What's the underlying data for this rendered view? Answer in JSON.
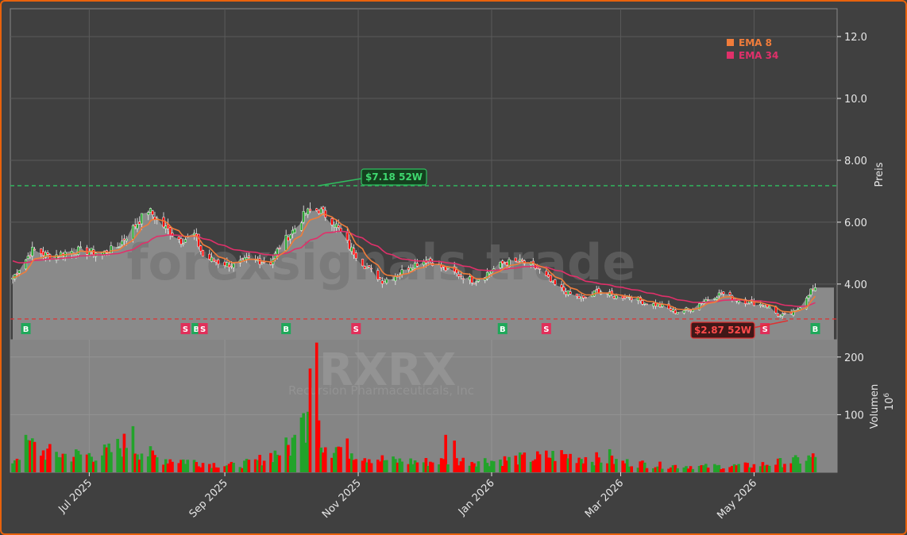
{
  "chart_data": {
    "type": "candlestick",
    "ticker_watermark": "RXRX",
    "company_watermark": "Recursion Pharmaceuticals, Inc",
    "site_watermark": "forexsignals.trade",
    "price_axis": {
      "label": "Preis",
      "ylim": [
        2.2,
        12.9
      ],
      "ticks": [
        "4.00",
        "6.00",
        "8.00",
        "10.0",
        "12.0"
      ]
    },
    "volume_axis": {
      "label": "Volumen",
      "unit": "10^6",
      "ylim": [
        0,
        230
      ],
      "ticks": [
        "100",
        "200"
      ]
    },
    "x_axis": {
      "ticks": [
        {
          "date": "2025-07-01",
          "label": "Jul 2025"
        },
        {
          "date": "2025-09-01",
          "label": "Sep 2025"
        },
        {
          "date": "2025-11-01",
          "label": "Nov 2025"
        },
        {
          "date": "2026-01-01",
          "label": "Jan 2026"
        },
        {
          "date": "2026-03-01",
          "label": "Mar 2026"
        },
        {
          "date": "2026-05-01",
          "label": "May 2026"
        }
      ]
    },
    "legend": [
      {
        "name": "EMA 8",
        "color": "#f07c3a"
      },
      {
        "name": "EMA 34",
        "color": "#e0306a"
      }
    ],
    "high_52w": {
      "value": 7.18,
      "label": "$7.18 52W",
      "date": "2025-10-13"
    },
    "low_52w": {
      "value": 2.87,
      "label": "$2.87 52W",
      "date": "2026-05-13"
    },
    "close_anchors": [
      [
        "2025-05-27",
        4.2
      ],
      [
        "2025-06-05",
        5.1
      ],
      [
        "2025-06-13",
        4.9
      ],
      [
        "2025-06-25",
        5.1
      ],
      [
        "2025-07-07",
        5.0
      ],
      [
        "2025-07-14",
        5.2
      ],
      [
        "2025-07-22",
        5.9
      ],
      [
        "2025-07-28",
        6.4
      ],
      [
        "2025-08-05",
        5.8
      ],
      [
        "2025-08-12",
        5.4
      ],
      [
        "2025-08-18",
        5.6
      ],
      [
        "2025-08-22",
        4.9
      ],
      [
        "2025-08-29",
        4.7
      ],
      [
        "2025-09-05",
        4.6
      ],
      [
        "2025-09-12",
        4.8
      ],
      [
        "2025-09-22",
        4.7
      ],
      [
        "2025-09-26",
        5.2
      ],
      [
        "2025-10-03",
        5.8
      ],
      [
        "2025-10-08",
        6.3
      ],
      [
        "2025-10-14",
        6.4
      ],
      [
        "2025-10-21",
        6.0
      ],
      [
        "2025-10-28",
        5.2
      ],
      [
        "2025-11-04",
        4.6
      ],
      [
        "2025-11-12",
        4.1
      ],
      [
        "2025-11-19",
        4.3
      ],
      [
        "2025-11-25",
        4.6
      ],
      [
        "2025-12-03",
        4.8
      ],
      [
        "2025-12-10",
        4.5
      ],
      [
        "2025-12-17",
        4.3
      ],
      [
        "2025-12-24",
        4.1
      ],
      [
        "2025-12-31",
        4.4
      ],
      [
        "2026-01-07",
        4.7
      ],
      [
        "2026-01-15",
        4.7
      ],
      [
        "2026-01-22",
        4.5
      ],
      [
        "2026-01-29",
        4.0
      ],
      [
        "2026-02-05",
        3.7
      ],
      [
        "2026-02-12",
        3.5
      ],
      [
        "2026-02-19",
        3.8
      ],
      [
        "2026-02-26",
        3.6
      ],
      [
        "2026-03-05",
        3.6
      ],
      [
        "2026-03-12",
        3.4
      ],
      [
        "2026-03-19",
        3.3
      ],
      [
        "2026-03-26",
        3.1
      ],
      [
        "2026-04-02",
        3.2
      ],
      [
        "2026-04-09",
        3.5
      ],
      [
        "2026-04-16",
        3.7
      ],
      [
        "2026-04-23",
        3.5
      ],
      [
        "2026-04-30",
        3.4
      ],
      [
        "2026-05-07",
        3.3
      ],
      [
        "2026-05-13",
        2.95
      ],
      [
        "2026-05-20",
        3.1
      ],
      [
        "2026-05-27",
        3.8
      ]
    ],
    "volume_anchors": [
      [
        "2025-05-27",
        20
      ],
      [
        "2025-06-03",
        50
      ],
      [
        "2025-06-10",
        35
      ],
      [
        "2025-06-20",
        30
      ],
      [
        "2025-07-01",
        30
      ],
      [
        "2025-07-10",
        35
      ],
      [
        "2025-07-18",
        50
      ],
      [
        "2025-07-24",
        40
      ],
      [
        "2025-08-01",
        25
      ],
      [
        "2025-08-15",
        20
      ],
      [
        "2025-08-25",
        15
      ],
      [
        "2025-09-05",
        12
      ],
      [
        "2025-09-15",
        18
      ],
      [
        "2025-09-25",
        35
      ],
      [
        "2025-10-01",
        45
      ],
      [
        "2025-10-06",
        70
      ],
      [
        "2025-10-10",
        130
      ],
      [
        "2025-10-14",
        60
      ],
      [
        "2025-10-20",
        45
      ],
      [
        "2025-10-28",
        40
      ],
      [
        "2025-11-05",
        28
      ],
      [
        "2025-11-15",
        20
      ],
      [
        "2025-12-01",
        18
      ],
      [
        "2025-12-15",
        20
      ],
      [
        "2026-01-01",
        20
      ],
      [
        "2026-01-20",
        25
      ],
      [
        "2026-02-01",
        30
      ],
      [
        "2026-02-15",
        25
      ],
      [
        "2026-03-01",
        18
      ],
      [
        "2026-03-20",
        12
      ],
      [
        "2026-04-10",
        10
      ],
      [
        "2026-05-01",
        12
      ],
      [
        "2026-05-20",
        20
      ],
      [
        "2026-05-27",
        25
      ]
    ],
    "volume_spikes": [
      {
        "date": "2025-06-04",
        "value": 55
      },
      {
        "date": "2025-07-21",
        "value": 80
      },
      {
        "date": "2025-10-02",
        "value": 60
      },
      {
        "date": "2025-10-06",
        "value": 95
      },
      {
        "date": "2025-10-09",
        "value": 105
      },
      {
        "date": "2025-10-10",
        "value": 180
      },
      {
        "date": "2025-10-13",
        "value": 225
      },
      {
        "date": "2025-10-14",
        "value": 90
      },
      {
        "date": "2025-12-11",
        "value": 65
      },
      {
        "date": "2025-12-15",
        "value": 55
      },
      {
        "date": "2026-02-24",
        "value": 40
      }
    ],
    "signals": [
      {
        "date": "2025-06-02",
        "type": "B"
      },
      {
        "date": "2025-08-14",
        "type": "S"
      },
      {
        "date": "2025-08-19",
        "type": "B"
      },
      {
        "date": "2025-08-22",
        "type": "S"
      },
      {
        "date": "2025-09-29",
        "type": "B"
      },
      {
        "date": "2025-10-31",
        "type": "S"
      },
      {
        "date": "2026-01-06",
        "type": "B"
      },
      {
        "date": "2026-01-26",
        "type": "S"
      },
      {
        "date": "2026-04-20",
        "type": "B"
      },
      {
        "date": "2026-05-06",
        "type": "S"
      },
      {
        "date": "2026-05-29",
        "type": "B"
      }
    ],
    "colors": {
      "up": "#22a32a",
      "down": "#ff0000",
      "buy": "#1fa85a",
      "sell": "#e0305a",
      "high_line": "#2fbf5f",
      "low_line": "#e03030"
    }
  }
}
